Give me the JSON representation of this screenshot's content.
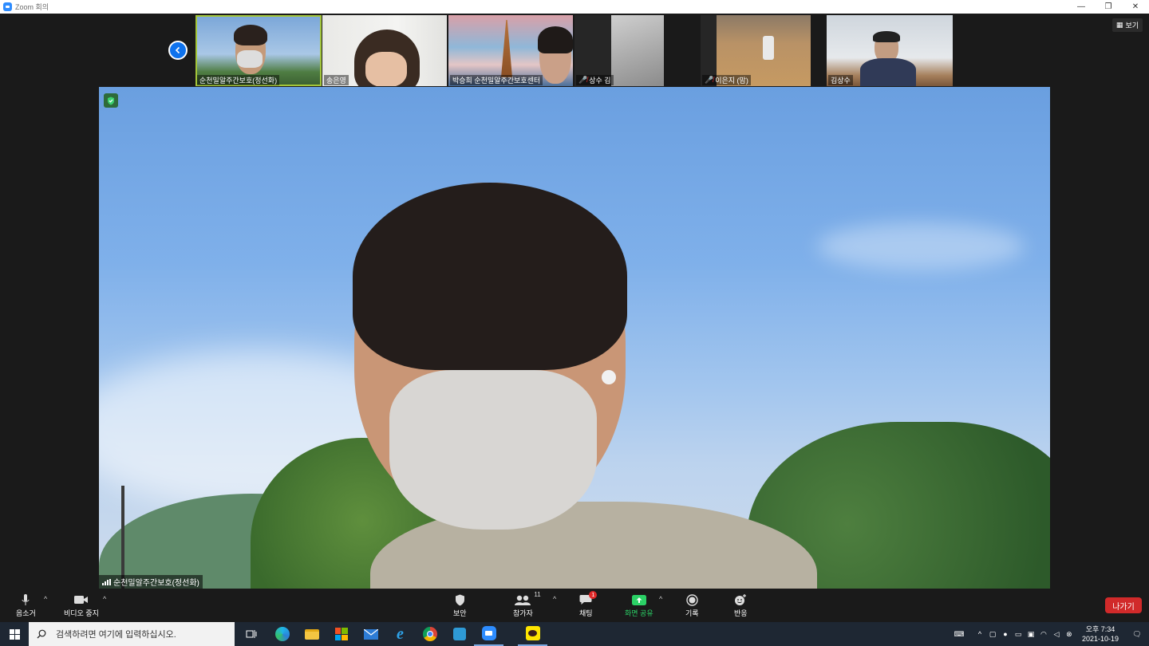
{
  "window": {
    "title": "Zoom 회의",
    "controls": [
      "—",
      "❐",
      "✕"
    ]
  },
  "view_button": {
    "label": "보기"
  },
  "thumbnails": [
    {
      "name": "순천밀알주간보호(정선화)",
      "muted": false,
      "active": true
    },
    {
      "name": "송은영",
      "muted": false,
      "active": false
    },
    {
      "name": "박승희 순천밀알주간보호센터",
      "muted": false,
      "active": false
    },
    {
      "name": "상수 김",
      "muted": true,
      "active": false
    },
    {
      "name": "이은지 (맘)",
      "muted": true,
      "active": false
    },
    {
      "name": "김상수",
      "muted": false,
      "active": false
    }
  ],
  "main_video": {
    "name": "순천밀알주간보호(정선화)"
  },
  "toolbar": {
    "audio": "음소거",
    "video": "비디오 중지",
    "security": "보안",
    "participants": "참가자",
    "participants_count": "11",
    "chat": "채팅",
    "chat_badge": "1",
    "share": "화면 공유",
    "record": "기록",
    "reactions": "반응",
    "leave": "나가기"
  },
  "taskbar": {
    "search_placeholder": "검색하려면 여기에 입력하십시오.",
    "time": "오후 7:34",
    "date": "2021-10-19"
  },
  "colors": {
    "zoom_blue": "#0e72ed",
    "leave_red": "#d12a2a",
    "share_green": "#2bd166",
    "active_outline": "#a4c639"
  }
}
